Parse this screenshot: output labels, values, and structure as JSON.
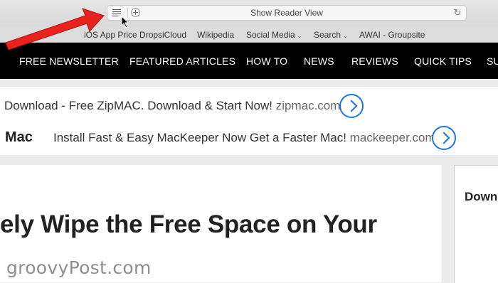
{
  "toolbar": {
    "address_label": "Show Reader View",
    "reader_icon": "reader-view-lines-icon",
    "plus_icon": "add-tab-plus-icon",
    "reload_icon": "reload-icon",
    "reload_glyph": "↻"
  },
  "bookmarks": [
    {
      "label": "iOS App Price Drops",
      "has_menu": false
    },
    {
      "label": "iCloud",
      "has_menu": false
    },
    {
      "label": "Wikipedia",
      "has_menu": false
    },
    {
      "label": "Social Media",
      "has_menu": true
    },
    {
      "label": "Search",
      "has_menu": true
    },
    {
      "label": "AWAI - Groupsite",
      "has_menu": false
    }
  ],
  "bookmark_chevron": "⌄",
  "nav": {
    "items": [
      "FREE NEWSLETTER",
      "FEATURED ARTICLES",
      "HOW TO",
      "NEWS",
      "REVIEWS",
      "QUICK TIPS",
      "SU"
    ]
  },
  "ads": {
    "ad1": {
      "text": "Download - Free ZipMAC. Download & Start Now!",
      "domain": "zipmac.com"
    },
    "ad2": {
      "title": "Mac",
      "text": "Install Fast & Easy MacKeeper Now Get a Faster Mac!",
      "domain": "mackeeper.com"
    }
  },
  "article": {
    "headline": "ely Wipe the Free Space on Your"
  },
  "sidebar": {
    "title": "Down"
  },
  "watermark": "groovyPost.com",
  "colors": {
    "nav_background": "#000000",
    "ad_arrow": "#1a73e8",
    "annotation_arrow": "#e8231f"
  }
}
